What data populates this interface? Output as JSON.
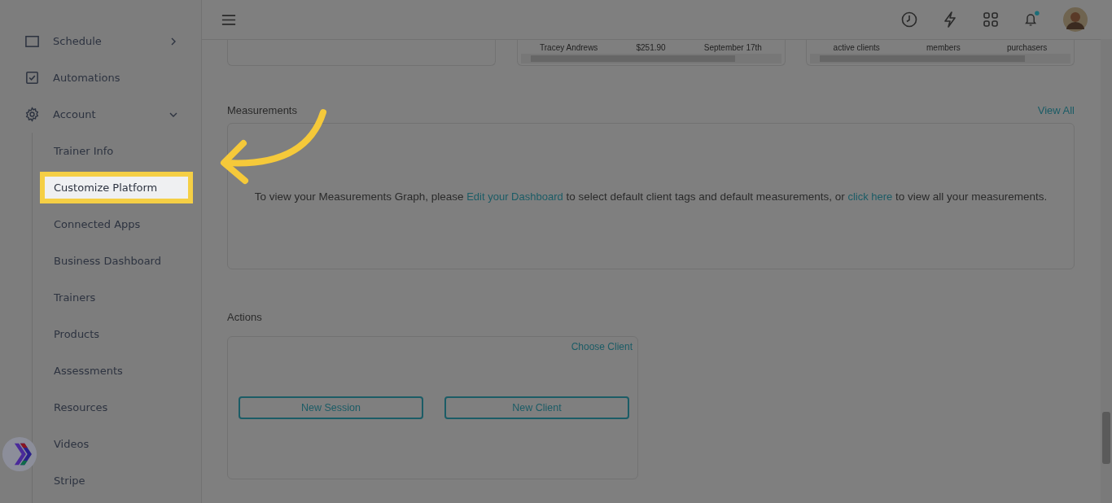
{
  "sidebar": {
    "items": [
      {
        "label": "Schedule",
        "kind": "group",
        "expanded": false
      },
      {
        "label": "Automations",
        "kind": "link"
      },
      {
        "label": "Account",
        "kind": "group",
        "expanded": true,
        "children": [
          {
            "label": "Trainer Info",
            "selected": false
          },
          {
            "label": "Customize Platform",
            "selected": true
          },
          {
            "label": "Connected Apps",
            "selected": false
          },
          {
            "label": "Business Dashboard",
            "selected": false
          },
          {
            "label": "Trainers",
            "selected": false
          },
          {
            "label": "Products",
            "selected": false
          },
          {
            "label": "Assessments",
            "selected": false
          },
          {
            "label": "Resources",
            "selected": false
          },
          {
            "label": "Videos",
            "selected": false
          },
          {
            "label": "Stripe",
            "selected": false
          }
        ]
      }
    ]
  },
  "top_cards": [
    {
      "cells": [
        "Tracey Andrews",
        "$251.90",
        "September 17th"
      ]
    },
    {
      "cells": [
        "active clients",
        "members",
        "purchasers"
      ]
    }
  ],
  "measurements": {
    "title": "Measurements",
    "view_all": "View All",
    "message": [
      "To view your Measurements Graph, please ",
      "Edit your Dashboard",
      " to select default client tags and default measurements, or ",
      "click here",
      " to view all your measurements."
    ]
  },
  "actions": {
    "title": "Actions",
    "choose_client": "Choose Client",
    "buttons": [
      "New Session",
      "New Client"
    ]
  }
}
